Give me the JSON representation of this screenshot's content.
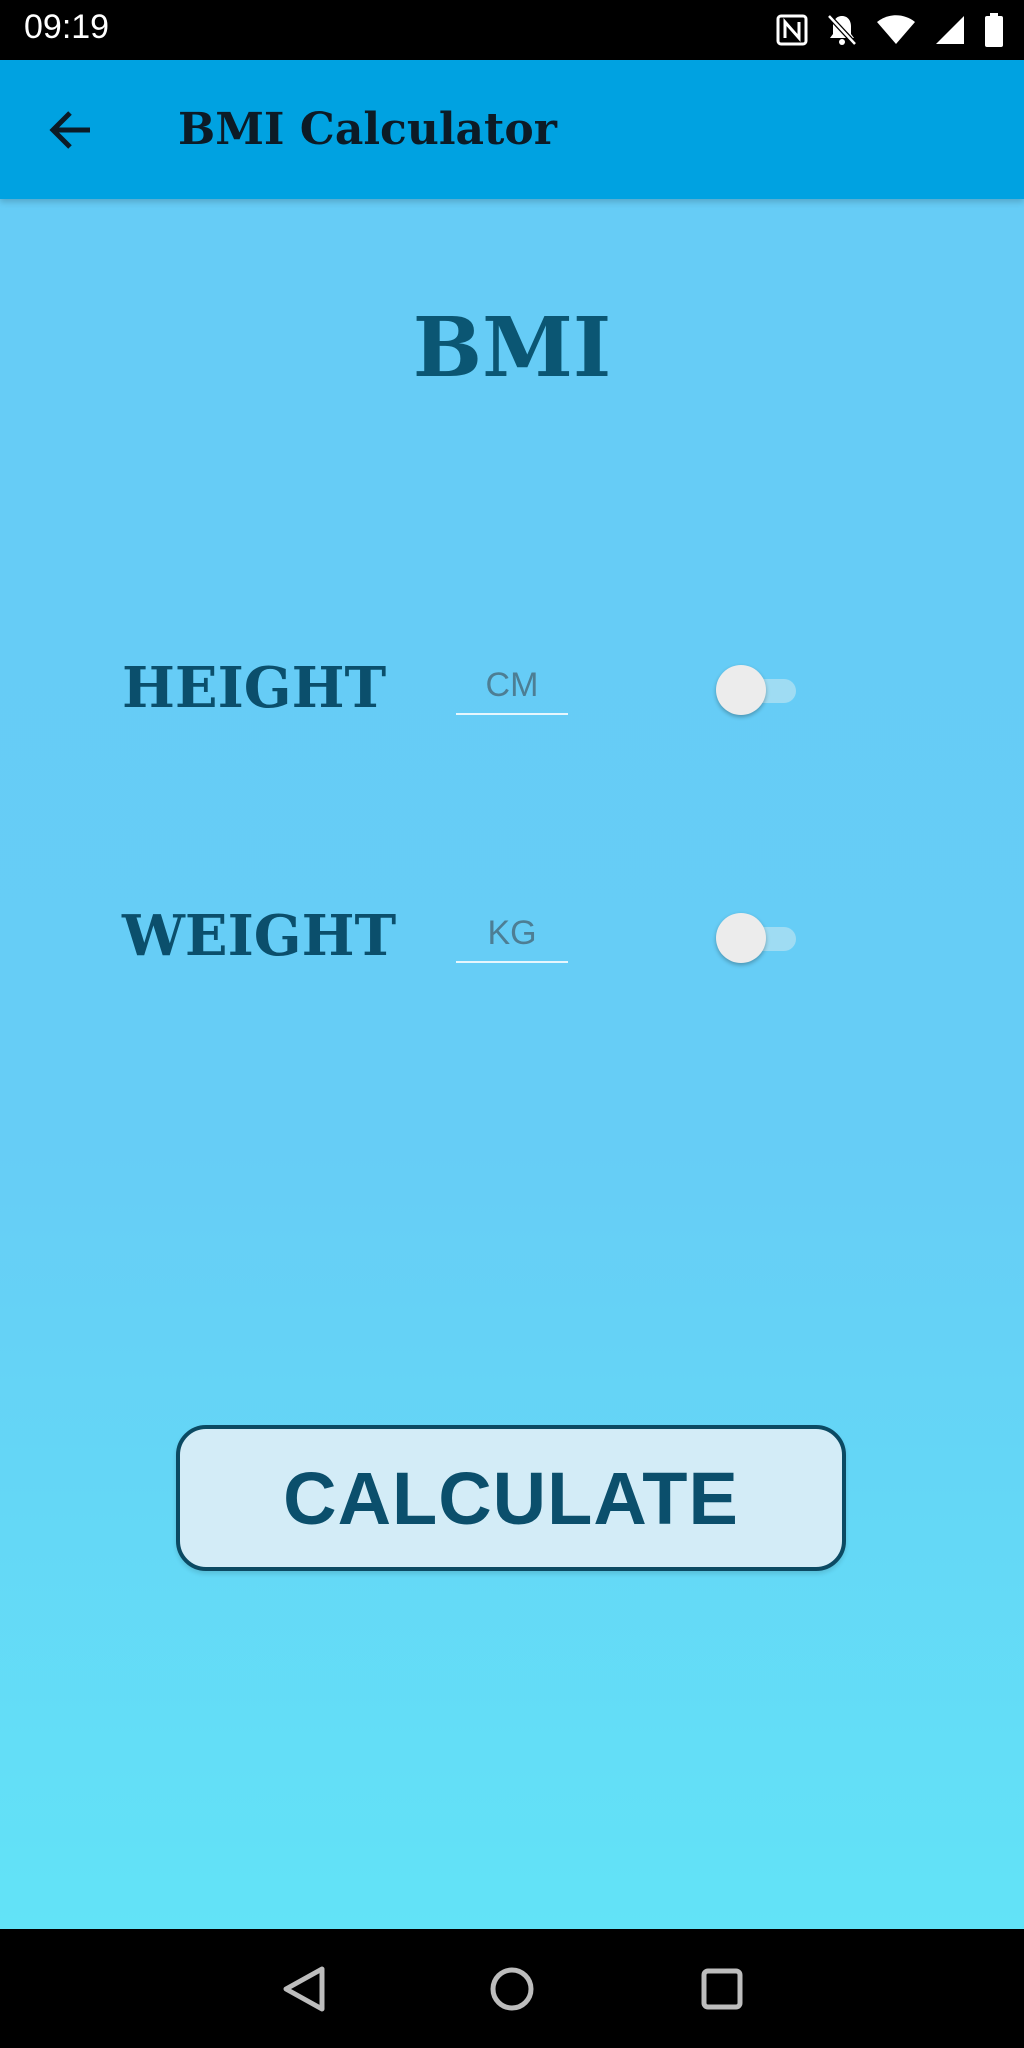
{
  "status_bar": {
    "time": "09:19",
    "icons": [
      "nfc-icon",
      "notifications-off-icon",
      "wifi-icon",
      "signal-icon",
      "battery-icon"
    ]
  },
  "app_bar": {
    "title": "BMI Calculator",
    "back_icon": "arrow-back-icon"
  },
  "main": {
    "heading": "BMI",
    "height_row": {
      "label": "HEIGHT",
      "placeholder": "CM",
      "toggle_on": false
    },
    "weight_row": {
      "label": "WEIGHT",
      "placeholder": "KG",
      "toggle_on": false
    },
    "calculate_label": "CALCULATE"
  },
  "nav_bar": {
    "icons": [
      "back-triangle-icon",
      "home-circle-icon",
      "recents-square-icon"
    ]
  },
  "colors": {
    "app_bar": "#00a2e1",
    "background_top": "#66ccf6",
    "background_bottom": "#62e3f7",
    "text_dark_blue": "#0b4f6c",
    "button_fill": "#d3ecf7"
  }
}
